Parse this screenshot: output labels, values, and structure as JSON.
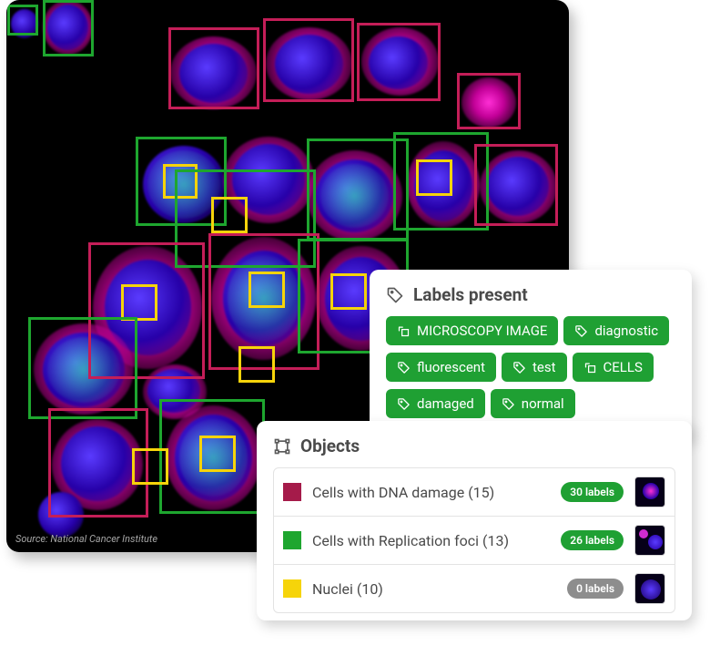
{
  "source_label": "Source: National Cancer Institute",
  "colors": {
    "magenta": "#c41e58",
    "green": "#1ea62f",
    "yellow": "#f6d40a",
    "tag_green": "#1fa033",
    "pill_gray": "#8d8d8d"
  },
  "labels_panel": {
    "title": "Labels present",
    "tags": [
      {
        "kind": "group",
        "text": "MICROSCOPY IMAGE"
      },
      {
        "kind": "tag",
        "text": "diagnostic"
      },
      {
        "kind": "tag",
        "text": "fluorescent"
      },
      {
        "kind": "tag",
        "text": "test"
      },
      {
        "kind": "group",
        "text": "CELLS"
      },
      {
        "kind": "tag",
        "text": "damaged"
      },
      {
        "kind": "tag",
        "text": "normal"
      }
    ]
  },
  "objects_panel": {
    "title": "Objects",
    "rows": [
      {
        "color": "#a51b4a",
        "name": "Cells with DNA damage (15)",
        "pill": "30 labels",
        "pill_color": "green"
      },
      {
        "color": "#1ea62f",
        "name": "Cells with Replication foci (13)",
        "pill": "26 labels",
        "pill_color": "green"
      },
      {
        "color": "#f6d40a",
        "name": "Nuclei (10)",
        "pill": "0 labels",
        "pill_color": "gray"
      }
    ]
  }
}
